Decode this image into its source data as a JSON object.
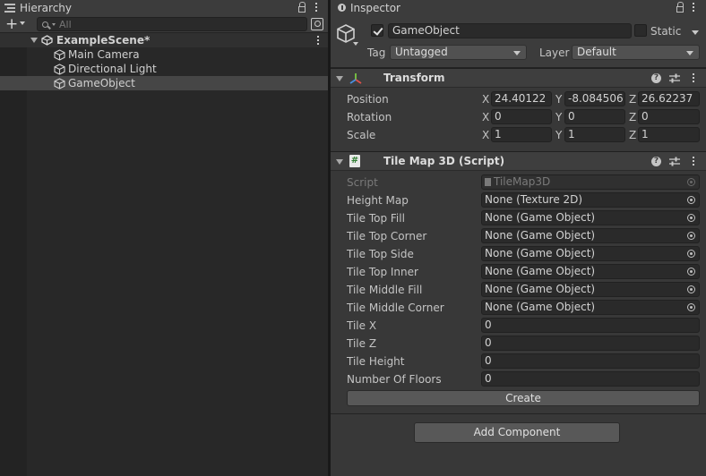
{
  "hierarchy": {
    "tab_title": "Hierarchy",
    "search_placeholder": "All",
    "scene_name": "ExampleScene*",
    "items": [
      {
        "label": "Main Camera",
        "selected": false
      },
      {
        "label": "Directional Light",
        "selected": false
      },
      {
        "label": "GameObject",
        "selected": true
      }
    ]
  },
  "inspector": {
    "tab_title": "Inspector",
    "object_name": "GameObject",
    "active": true,
    "static_label": "Static",
    "static_checked": false,
    "tag_label": "Tag",
    "tag_value": "Untagged",
    "layer_label": "Layer",
    "layer_value": "Default",
    "transform": {
      "title": "Transform",
      "rows": [
        {
          "label": "Position",
          "x": "24.40122",
          "y": "-8.084506",
          "z": "26.62237"
        },
        {
          "label": "Rotation",
          "x": "0",
          "y": "0",
          "z": "0"
        },
        {
          "label": "Scale",
          "x": "1",
          "y": "1",
          "z": "1"
        }
      ]
    },
    "tilemap": {
      "title": "Tile Map 3D (Script)",
      "script_label": "Script",
      "script_value": "TileMap3D",
      "object_fields": [
        {
          "label": "Height Map",
          "value": "None (Texture 2D)"
        },
        {
          "label": "Tile Top Fill",
          "value": "None (Game Object)"
        },
        {
          "label": "Tile Top Corner",
          "value": "None (Game Object)"
        },
        {
          "label": "Tile Top Side",
          "value": "None (Game Object)"
        },
        {
          "label": "Tile Top Inner",
          "value": "None (Game Object)"
        },
        {
          "label": "Tile Middle Fill",
          "value": "None (Game Object)"
        },
        {
          "label": "Tile Middle Corner",
          "value": "None (Game Object)"
        }
      ],
      "int_fields": [
        {
          "label": "Tile X",
          "value": "0"
        },
        {
          "label": "Tile Z",
          "value": "0"
        },
        {
          "label": "Tile Height",
          "value": "0"
        },
        {
          "label": "Number Of Floors",
          "value": "0"
        }
      ],
      "create_label": "Create"
    },
    "add_component_label": "Add Component"
  },
  "axis_labels": {
    "x": "X",
    "y": "Y",
    "z": "Z"
  },
  "colors": {
    "selection": "#464646",
    "panel": "#383838",
    "field": "#2a2a2a",
    "button": "#585858"
  }
}
